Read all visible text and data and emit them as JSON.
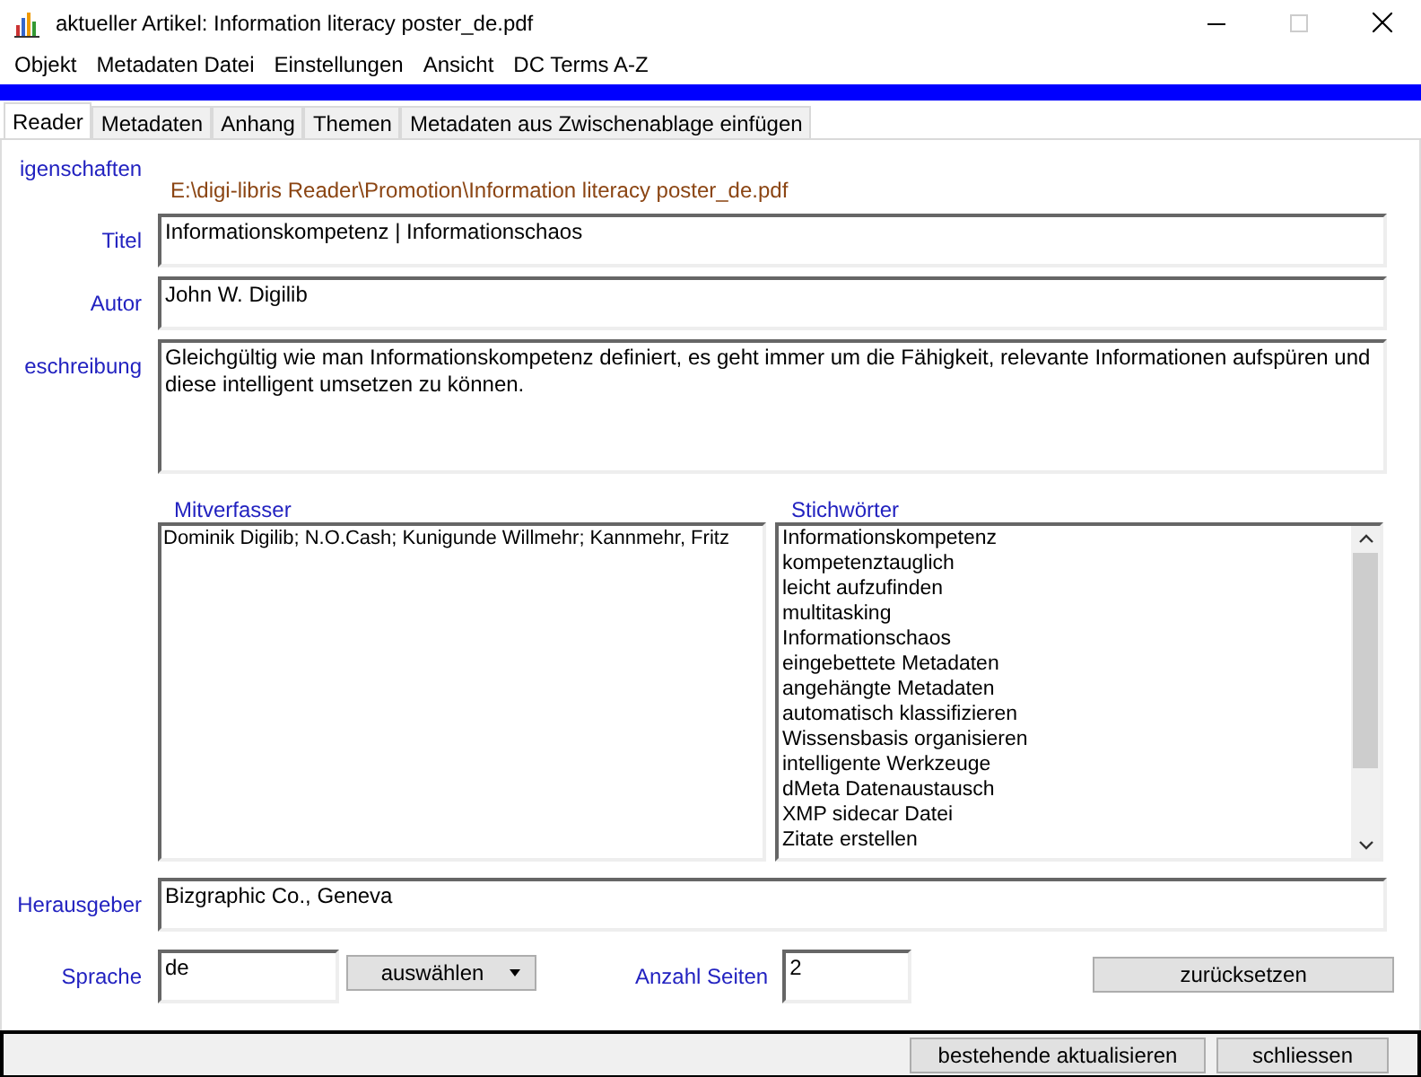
{
  "window": {
    "title": "aktueller Artikel: Information literacy poster_de.pdf"
  },
  "menu": [
    "Objekt",
    "Metadaten Datei",
    "Einstellungen",
    "Ansicht",
    "DC Terms A-Z"
  ],
  "tabs": [
    {
      "label": "Reader",
      "selected": true
    },
    {
      "label": "Metadaten",
      "selected": false
    },
    {
      "label": "Anhang",
      "selected": false
    },
    {
      "label": "Themen",
      "selected": false
    },
    {
      "label": "Metadaten aus Zwischenablage einfügen",
      "selected": false
    }
  ],
  "properties_label": "igenschaften",
  "file_path": "E:\\digi-libris Reader\\Promotion\\Information literacy poster_de.pdf",
  "fields": [
    {
      "label": "Titel",
      "value": "Informationskompetenz | Informationschaos",
      "kind": "line"
    },
    {
      "label": "Autor",
      "value": "John W. Digilib",
      "kind": "line"
    },
    {
      "label": "eschreibung",
      "value": "Gleichgültig wie man Informationskompetenz definiert, es geht immer um die Fähigkeit, relevante Informationen aufspüren und diese intelligent umsetzen zu können.",
      "kind": "area"
    }
  ],
  "coauthors": {
    "label": "Mitverfasser",
    "value": "Dominik Digilib; N.O.Cash; Kunigunde Willmehr; Kannmehr, Fritz"
  },
  "keywords": {
    "label": "Stichwörter",
    "items": [
      "Informationskompetenz",
      "kompetenztauglich",
      "leicht aufzufinden",
      "multitasking",
      "Informationschaos",
      "eingebettete Metadaten",
      "angehängte Metadaten",
      "automatisch klassifizieren",
      "Wissensbasis organisieren",
      "intelligente Werkzeuge",
      "dMeta Datenaustausch",
      "XMP sidecar Datei",
      "Zitate erstellen"
    ]
  },
  "publisher": {
    "label": "Herausgeber",
    "value": "Bizgraphic Co., Geneva"
  },
  "language": {
    "label": "Sprache",
    "value": "de",
    "button": "auswählen"
  },
  "pages": {
    "label": "Anzahl Seiten",
    "value": "2"
  },
  "reset_button": "zurücksetzen",
  "footer_buttons": [
    "bestehende aktualisieren",
    "schliessen"
  ]
}
